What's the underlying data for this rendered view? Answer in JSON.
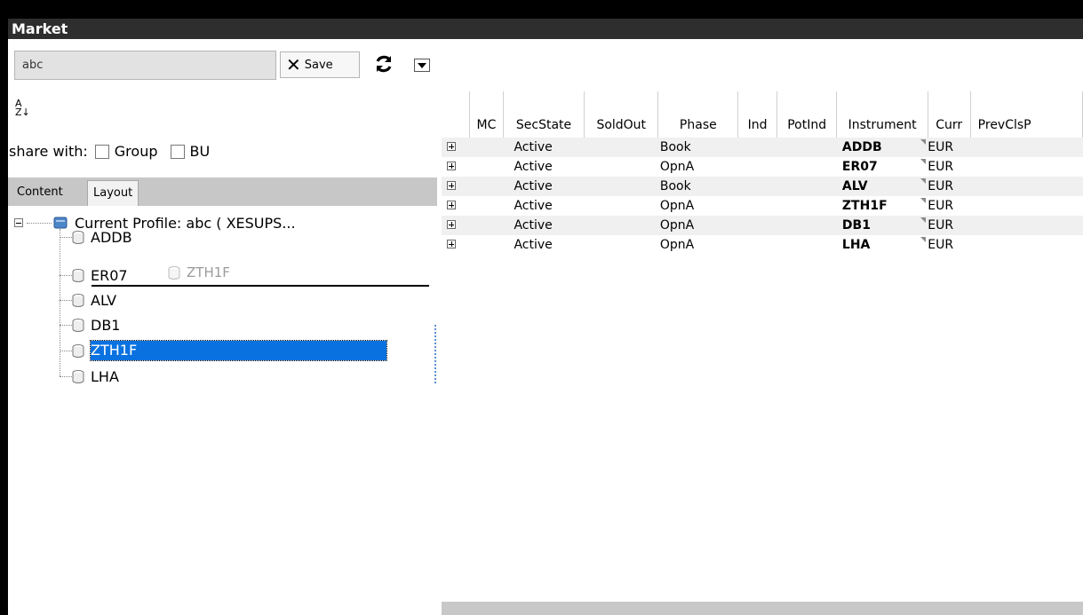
{
  "window": {
    "title": "Market"
  },
  "toolbar": {
    "search_value": "abc",
    "save_label": "Save",
    "close_icon": "x-icon",
    "refresh_icon": "refresh-icon",
    "dropdown_icon": "chevron-down-icon"
  },
  "sort_icon": "sort-az-icon",
  "share": {
    "label": "share with:",
    "group_label": "Group",
    "bu_label": "BU"
  },
  "tabs": [
    {
      "label": "Content"
    },
    {
      "label": "Layout",
      "active": true
    }
  ],
  "tree": {
    "root_label": "Current Profile: abc ( XESUPS...",
    "items": [
      {
        "label": "ADDB"
      },
      {
        "label": "ER07"
      },
      {
        "label": "ALV"
      },
      {
        "label": "DB1"
      },
      {
        "label": "ZTH1F",
        "selected": true
      },
      {
        "label": "LHA"
      }
    ],
    "drag_ghost_label": "ZTH1F"
  },
  "grid": {
    "columns": [
      "MC",
      "SecState",
      "SoldOut",
      "Phase",
      "Ind",
      "PotInd",
      "Instrument",
      "Curr",
      "PrevClsP"
    ],
    "rows": [
      {
        "secstate": "Active",
        "phase": "Book",
        "instrument": "ADDB",
        "curr": "EUR"
      },
      {
        "secstate": "Active",
        "phase": "OpnA",
        "instrument": "ER07",
        "curr": "EUR"
      },
      {
        "secstate": "Active",
        "phase": "Book",
        "instrument": "ALV",
        "curr": "EUR"
      },
      {
        "secstate": "Active",
        "phase": "OpnA",
        "instrument": "ZTH1F",
        "curr": "EUR"
      },
      {
        "secstate": "Active",
        "phase": "OpnA",
        "instrument": "DB1",
        "curr": "EUR"
      },
      {
        "secstate": "Active",
        "phase": "OpnA",
        "instrument": "LHA",
        "curr": "EUR"
      }
    ]
  },
  "colors": {
    "selection": "#0a72e0",
    "titlebar": "#2e2e2e",
    "tabbar": "#c7c7c7"
  }
}
